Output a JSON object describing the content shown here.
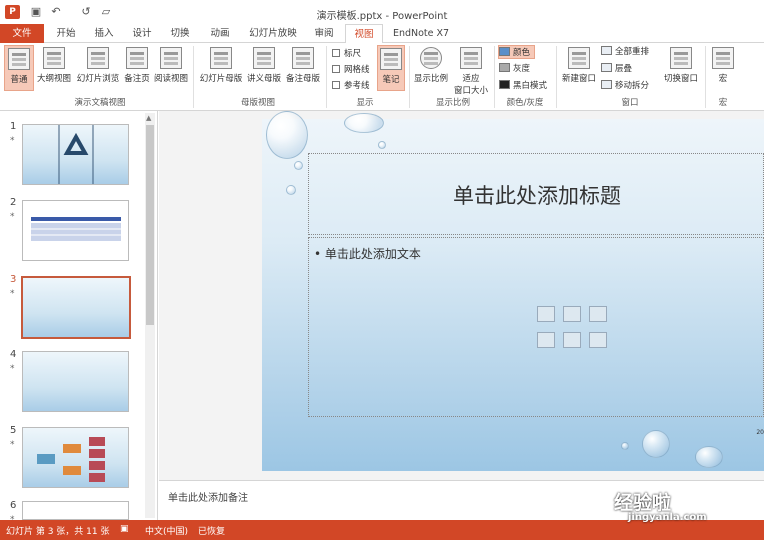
{
  "window": {
    "title": "演示模板.pptx - PowerPoint"
  },
  "tabs": [
    "文件",
    "开始",
    "插入",
    "设计",
    "切换",
    "动画",
    "幻灯片放映",
    "审阅",
    "视图",
    "EndNote X7"
  ],
  "ribbon": {
    "views": [
      "普通",
      "大纲视图",
      "幻灯片浏览",
      "备注页",
      "阅读视图"
    ],
    "views_group": "演示文稿视图",
    "masters": [
      "幻灯片母版",
      "讲义母版",
      "备注母版"
    ],
    "masters_group": "母版视图",
    "show": {
      "ruler": "标尺",
      "gridlines": "网格线",
      "guides": "参考线",
      "notes": "笔记",
      "group": "显示"
    },
    "zoom": {
      "zoom": "显示比例",
      "fit": "适应\n窗口大小",
      "group": "显示比例"
    },
    "color": {
      "color": "颜色",
      "gray": "灰度",
      "bw": "黑白模式",
      "group": "颜色/灰度"
    },
    "window": {
      "new": "新建窗口",
      "arrange": "全部重排",
      "cascade": "层叠",
      "split": "移动拆分",
      "switch": "切换窗口",
      "group": "窗口"
    },
    "macros": {
      "macro": "宏",
      "group": "宏"
    }
  },
  "slides": [
    {
      "n": "1",
      "star": "*"
    },
    {
      "n": "2",
      "star": "*"
    },
    {
      "n": "3",
      "star": "*"
    },
    {
      "n": "4",
      "star": "*"
    },
    {
      "n": "5",
      "star": "*"
    },
    {
      "n": "6",
      "star": "*"
    }
  ],
  "slide": {
    "title": "单击此处添加标题",
    "body": "• 单击此处添加文本",
    "page": "20"
  },
  "notes": "单击此处添加备注",
  "status": {
    "slide": "幻灯片 第 3 张，共 11 张",
    "lang": "中文(中国)",
    "recovered": "已恢复"
  },
  "watermark": {
    "text": "经验啦",
    "url": "jingyanla.com"
  },
  "colors": {
    "accent": "#d24726"
  }
}
